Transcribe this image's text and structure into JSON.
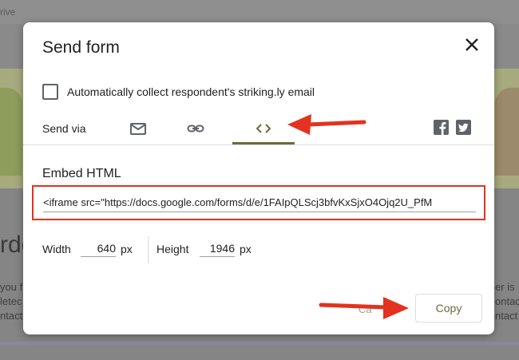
{
  "background": {
    "drive_label": "rive",
    "heading_fragment": "rde",
    "left_text": [
      "you f",
      "letec",
      "ntact"
    ],
    "right_text": [
      "er is",
      "ontac",
      "ntact"
    ]
  },
  "dialog": {
    "title": "Send form",
    "checkbox_label": "Automatically collect respondent's striking.ly email",
    "send_via_label": "Send via",
    "tabs": [
      {
        "name": "email",
        "icon": "mail-icon",
        "active": false
      },
      {
        "name": "link",
        "icon": "link-icon",
        "active": false
      },
      {
        "name": "embed",
        "icon": "code-icon",
        "active": true
      }
    ],
    "social": [
      "facebook-icon",
      "twitter-icon"
    ],
    "embed_section_title": "Embed HTML",
    "embed_code": "<iframe src=\"https://docs.google.com/forms/d/e/1FAIpQLScj3bfvKxSjxO4Ojq2U_PfM",
    "width_label": "Width",
    "width_value": "640",
    "height_label": "Height",
    "height_value": "1946",
    "unit": "px",
    "cancel_label": "Ca",
    "copy_label": "Copy"
  },
  "colors": {
    "accent": "#6b6b3a",
    "highlight": "#e3321f",
    "overlay": "#8a8a8a"
  }
}
